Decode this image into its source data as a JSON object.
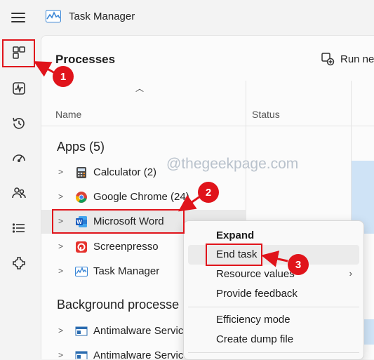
{
  "window": {
    "title": "Task Manager",
    "icon": "task-manager-icon"
  },
  "rail": [
    {
      "id": "processes",
      "icon": "processes-icon",
      "selected": true
    },
    {
      "id": "performance",
      "icon": "performance-icon"
    },
    {
      "id": "app-history",
      "icon": "history-icon"
    },
    {
      "id": "startup-apps",
      "icon": "startup-icon"
    },
    {
      "id": "users",
      "icon": "users-icon"
    },
    {
      "id": "details",
      "icon": "details-icon"
    },
    {
      "id": "services",
      "icon": "services-icon"
    }
  ],
  "header": {
    "title": "Processes",
    "run_label": "Run ne"
  },
  "table": {
    "columns": {
      "name": "Name",
      "status": "Status"
    },
    "apps_group": "Apps (5)",
    "apps": [
      {
        "label": "Calculator (2)",
        "icon": "calculator-icon"
      },
      {
        "label": "Google Chrome (24)",
        "icon": "chrome-icon"
      },
      {
        "label": "Microsoft Word",
        "icon": "word-icon",
        "selected": true
      },
      {
        "label": "Screenpresso",
        "icon": "screenpresso-icon"
      },
      {
        "label": "Task Manager",
        "icon": "task-manager-icon"
      }
    ],
    "bg_group": "Background processe",
    "bg": [
      {
        "label": "Antimalware Service",
        "icon": "antimalware-icon"
      },
      {
        "label": "Antimalware Service",
        "icon": "antimalware-icon"
      }
    ]
  },
  "watermark": "@thegeekpage.com",
  "context_menu": {
    "expand": "Expand",
    "end_task": "End task",
    "resource_values": "Resource values",
    "resource_values_chevron": "›",
    "provide_feedback": "Provide feedback",
    "efficiency_mode": "Efficiency mode",
    "create_dump_file": "Create dump file"
  },
  "annotations": {
    "step1": "1",
    "step2": "2",
    "step3": "3",
    "color": "#e0141b"
  }
}
